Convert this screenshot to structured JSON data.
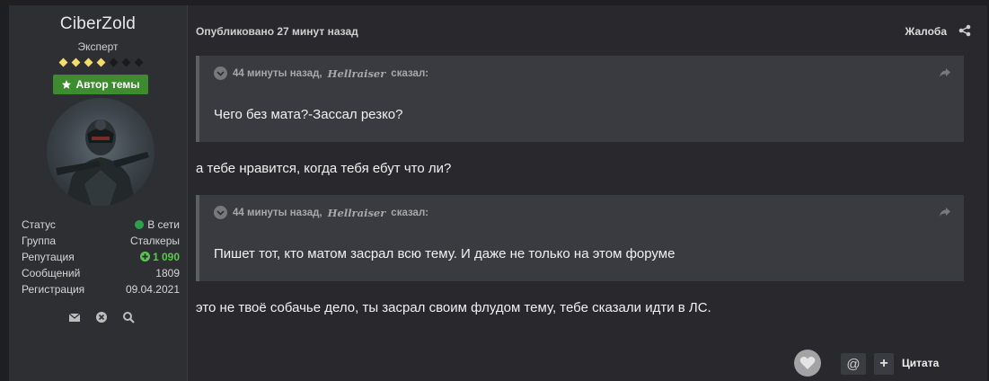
{
  "author": {
    "name": "CiberZold",
    "rank": "Эксперт",
    "pips_filled": 4,
    "pips_total": 7,
    "badge_label": "Автор темы",
    "badge_icon": "star-icon",
    "stats": [
      {
        "label": "Статус",
        "value": "В сети"
      },
      {
        "label": "Группа",
        "value": "Сталкеры"
      },
      {
        "label": "Репутация",
        "value": "1 090"
      },
      {
        "label": "Сообщений",
        "value": "1809"
      },
      {
        "label": "Регистрация",
        "value": "09.04.2021"
      }
    ],
    "actions": [
      "envelope-icon",
      "block-icon",
      "search-icon"
    ]
  },
  "post": {
    "meta": "Опубликовано 27 минут назад",
    "report_label": "Жалоба",
    "quotes": [
      {
        "time": "44 минуты назад,",
        "author": "Hellraiser",
        "said": "сказал:",
        "text": "Чего без мата?-Зассал резко?"
      },
      {
        "time": "44 минуты назад,",
        "author": "Hellraiser",
        "said": "сказал:",
        "text": "Пишет тот, кто матом засрал всю тему. И даже не только на этом форуме"
      }
    ],
    "replies": [
      "а тебе нравится, когда тебя ебут что ли?",
      "это не твоё собачье дело, ты засрал своим флудом тему, тебе сказали идти в ЛС."
    ]
  },
  "actions": {
    "mention": "@",
    "plus": "+",
    "quote_label": "Цитата"
  },
  "colors": {
    "badge": "#3d8c2f",
    "online": "#2fa04a",
    "reputation": "#5ac84e",
    "pip_on": "#f4dd6b"
  }
}
